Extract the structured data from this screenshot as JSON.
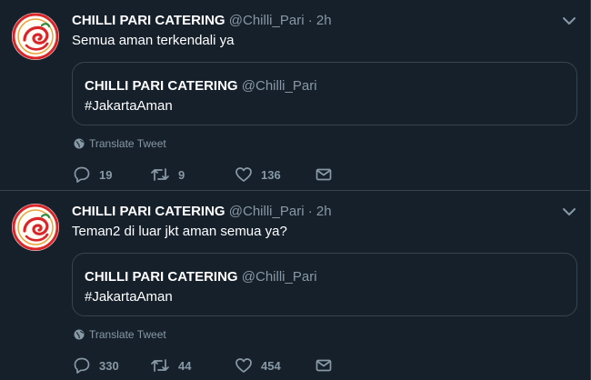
{
  "tweets": [
    {
      "name": "CHILLI PARI CATERING",
      "handle": "@Chilli_Pari",
      "separator": "·",
      "time": "2h",
      "text": "Semua aman terkendali ya",
      "quote": {
        "name": "CHILLI PARI CATERING",
        "handle": "@Chilli_Pari",
        "text": "#JakartaAman"
      },
      "translate_label": "Translate Tweet",
      "replies": "19",
      "retweets": "9",
      "likes": "136"
    },
    {
      "name": "CHILLI PARI CATERING",
      "handle": "@Chilli_Pari",
      "separator": "·",
      "time": "2h",
      "text": "Teman2 di luar jkt aman semua ya?",
      "quote": {
        "name": "CHILLI PARI CATERING",
        "handle": "@Chilli_Pari",
        "text": "#JakartaAman"
      },
      "translate_label": "Translate Tweet",
      "replies": "330",
      "retweets": "44",
      "likes": "454"
    }
  ],
  "icons": {
    "caret": "chevron-down-icon",
    "globe": "globe-icon",
    "reply": "reply-icon",
    "retweet": "retweet-icon",
    "like": "heart-icon",
    "dm": "envelope-icon"
  },
  "colors": {
    "background": "#15202b",
    "border": "#38444d",
    "secondary_text": "#8899a6",
    "primary_text": "#ffffff",
    "logo_red": "#d8262b"
  }
}
